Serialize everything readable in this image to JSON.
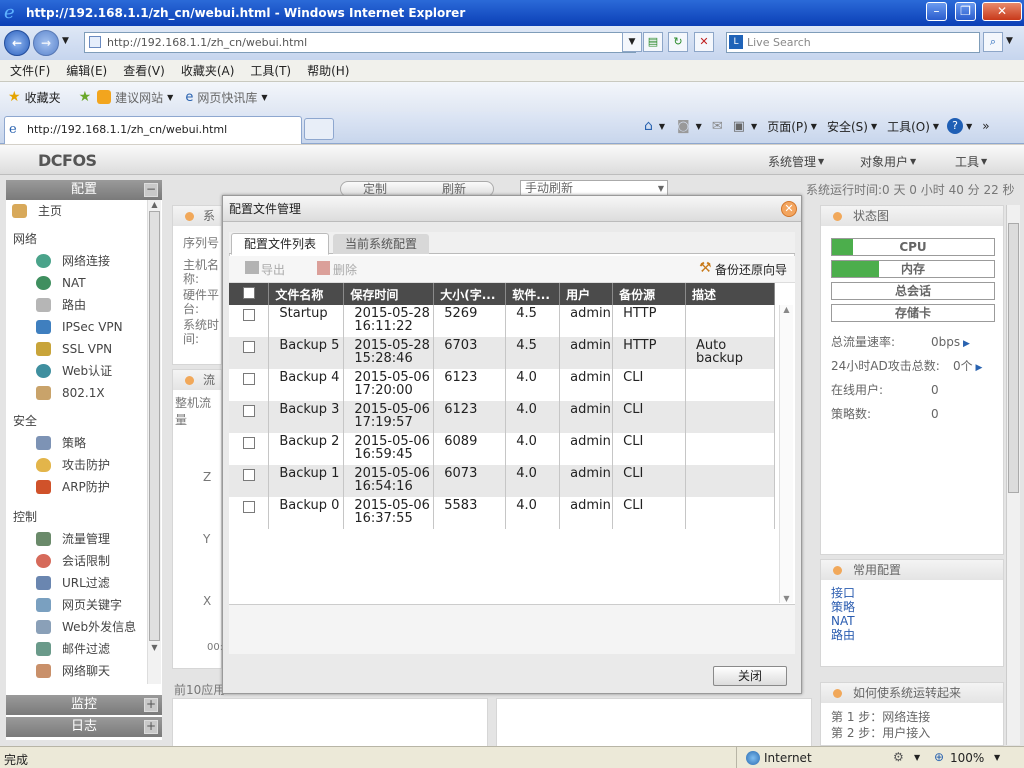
{
  "window": {
    "title": "http://192.168.1.1/zh_cn/webui.html - Windows Internet Explorer"
  },
  "address": {
    "url": "http://192.168.1.1/zh_cn/webui.html",
    "search_placeholder": "Live Search"
  },
  "menu": [
    "文件(F)",
    "编辑(E)",
    "查看(V)",
    "收藏夹(A)",
    "工具(T)",
    "帮助(H)"
  ],
  "favorites": {
    "label": "收藏夹",
    "items": [
      "建议网站",
      "网页快讯库"
    ]
  },
  "tab": {
    "title": "http://192.168.1.1/zh_cn/webui.html"
  },
  "commandbar": [
    "页面(P)",
    "安全(S)",
    "工具(O)"
  ],
  "app": {
    "logo": "DCFOS",
    "top_menu": [
      "系统管理",
      "对象用户",
      "工具"
    ],
    "uptime": "系统运行时间:0 天 0 小时 40 分 22 秒",
    "under_tabs": [
      "定制",
      "刷新"
    ],
    "refresh_select": "手动刷新"
  },
  "sidebar": {
    "header": "配置",
    "home": "主页",
    "sections": [
      {
        "title": "网络",
        "items": [
          "网络连接",
          "NAT",
          "路由",
          "IPSec VPN",
          "SSL VPN",
          "Web认证",
          "802.1X"
        ]
      },
      {
        "title": "安全",
        "items": [
          "策略",
          "攻击防护",
          "ARP防护"
        ]
      },
      {
        "title": "控制",
        "items": [
          "流量管理",
          "会话限制",
          "URL过滤",
          "网页关键字",
          "Web外发信息",
          "邮件过滤",
          "网络聊天"
        ]
      }
    ],
    "footer": [
      "监控",
      "日志"
    ]
  },
  "background": {
    "sys_panel_title": "系",
    "sys_labels": [
      "序列号",
      "主机名称:",
      "硬件平台:",
      "系统时间:"
    ],
    "flow_title": "流",
    "flow_label": "整机流量",
    "axis_labels": [
      "Z",
      "Y",
      "X",
      "00:"
    ],
    "bottom_label": "前10应用"
  },
  "modal": {
    "title": "配置文件管理",
    "tabs": [
      "配置文件列表",
      "当前系统配置"
    ],
    "toolbar": {
      "export": "导出",
      "delete": "删除",
      "wizard": "备份还原向导"
    },
    "columns": [
      "文件名称",
      "保存时间",
      "大小(字...",
      "软件...",
      "用户",
      "备份源",
      "描述"
    ],
    "rows": [
      {
        "name": "Startup",
        "date": "2015-05-28",
        "time": "16:11:22",
        "size": "5269",
        "ver": "4.5",
        "user": "admin",
        "source": "HTTP",
        "desc1": "",
        "desc2": ""
      },
      {
        "name": "Backup 5",
        "date": "2015-05-28",
        "time": "15:28:46",
        "size": "6703",
        "ver": "4.5",
        "user": "admin",
        "source": "HTTP",
        "desc1": "Auto",
        "desc2": "backup"
      },
      {
        "name": "Backup 4",
        "date": "2015-05-06",
        "time": "17:20:00",
        "size": "6123",
        "ver": "4.0",
        "user": "admin",
        "source": "CLI",
        "desc1": "",
        "desc2": ""
      },
      {
        "name": "Backup 3",
        "date": "2015-05-06",
        "time": "17:19:57",
        "size": "6123",
        "ver": "4.0",
        "user": "admin",
        "source": "CLI",
        "desc1": "",
        "desc2": ""
      },
      {
        "name": "Backup 2",
        "date": "2015-05-06",
        "time": "16:59:45",
        "size": "6089",
        "ver": "4.0",
        "user": "admin",
        "source": "CLI",
        "desc1": "",
        "desc2": ""
      },
      {
        "name": "Backup 1",
        "date": "2015-05-06",
        "time": "16:54:16",
        "size": "6073",
        "ver": "4.0",
        "user": "admin",
        "source": "CLI",
        "desc1": "",
        "desc2": ""
      },
      {
        "name": "Backup 0",
        "date": "2015-05-06",
        "time": "16:37:55",
        "size": "5583",
        "ver": "4.0",
        "user": "admin",
        "source": "CLI",
        "desc1": "",
        "desc2": ""
      }
    ],
    "close": "关闭"
  },
  "status_panel": {
    "title": "状态图",
    "bars": [
      {
        "label": "CPU",
        "level": 0.13
      },
      {
        "label": "内存",
        "level": 0.29
      },
      {
        "label": "总会话",
        "level": 0
      },
      {
        "label": "存储卡",
        "level": 0
      }
    ],
    "stats": [
      {
        "label": "总流量速率:",
        "value": "0bps"
      },
      {
        "label": "24小时AD攻击总数:",
        "value": "0个"
      },
      {
        "label": "在线用户:",
        "value": "0"
      },
      {
        "label": "策略数:",
        "value": "0"
      }
    ]
  },
  "common_config": {
    "title": "常用配置",
    "links": [
      "接口",
      "策略",
      "NAT",
      "路由"
    ]
  },
  "howto": {
    "title": "如何使系统运转起来",
    "steps": [
      "第 1 步：网络连接",
      "第 2 步：用户接入"
    ]
  },
  "statusbar": {
    "left": "完成",
    "zone": "Internet",
    "zoom": "100%"
  }
}
